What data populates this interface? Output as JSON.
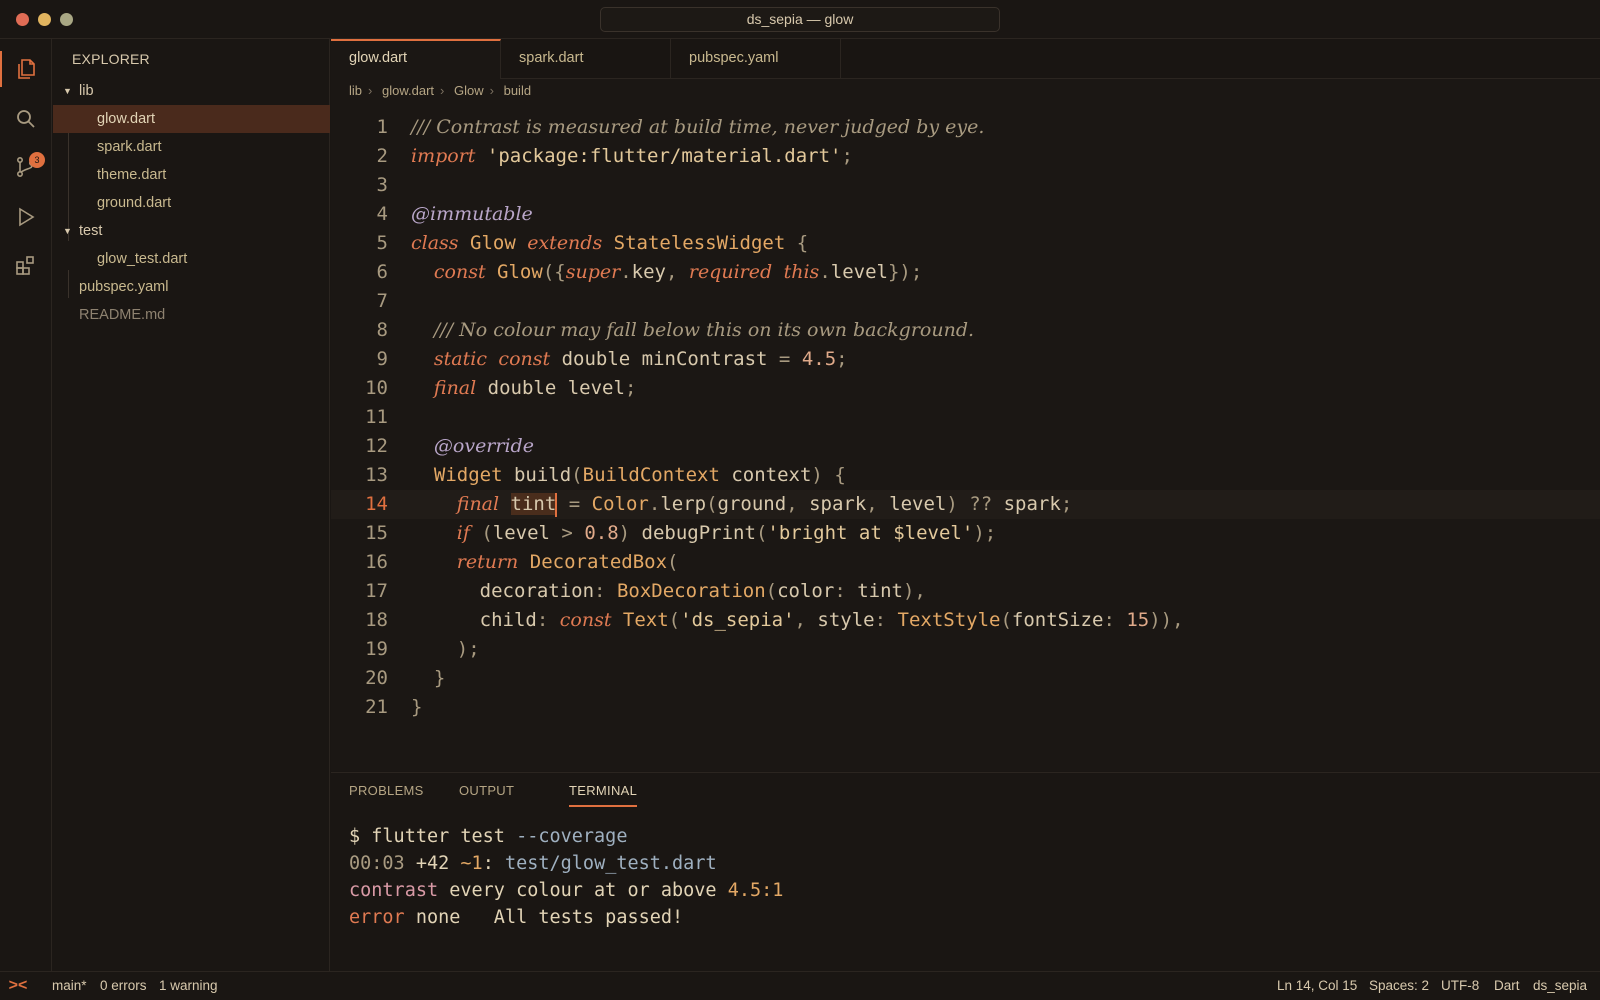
{
  "window": {
    "title": "ds_sepia — glow"
  },
  "activity_bar": {
    "scm_badge": "3"
  },
  "explorer": {
    "title": "EXPLORER",
    "items": [
      {
        "label": "lib",
        "type": "folder"
      },
      {
        "label": "glow.dart",
        "type": "file"
      },
      {
        "label": "spark.dart",
        "type": "file"
      },
      {
        "label": "theme.dart",
        "type": "file"
      },
      {
        "label": "ground.dart",
        "type": "file"
      },
      {
        "label": "test",
        "type": "folder"
      },
      {
        "label": "glow_test.dart",
        "type": "file"
      },
      {
        "label": "pubspec.yaml",
        "type": "file"
      },
      {
        "label": "README.md",
        "type": "file"
      }
    ]
  },
  "tabs": [
    "glow.dart",
    "spark.dart",
    "pubspec.yaml"
  ],
  "breadcrumb": [
    "lib",
    "glow.dart",
    "Glow",
    "build"
  ],
  "code": {
    "current_line": 14,
    "lines": [
      [
        [
          "c",
          "/// Contrast is measured at build time, never judged by eye."
        ]
      ],
      [
        [
          "k",
          "import"
        ],
        [
          "",
          " "
        ],
        [
          "s",
          "'package:flutter/material.dart'"
        ],
        [
          "p",
          ";"
        ]
      ],
      [],
      [
        [
          "a",
          "@immutable"
        ]
      ],
      [
        [
          "k",
          "class"
        ],
        [
          "",
          " "
        ],
        [
          "t",
          "Glow"
        ],
        [
          "",
          " "
        ],
        [
          "k",
          "extends"
        ],
        [
          "",
          " "
        ],
        [
          "t",
          "StatelessWidget"
        ],
        [
          "",
          " "
        ],
        [
          "p",
          "{"
        ]
      ],
      [
        [
          "",
          "  "
        ],
        [
          "k",
          "const"
        ],
        [
          "",
          " "
        ],
        [
          "t",
          "Glow"
        ],
        [
          "p",
          "({"
        ],
        [
          "k",
          "super"
        ],
        [
          "p",
          "."
        ],
        [
          "",
          "key"
        ],
        [
          "p",
          ", "
        ],
        [
          "k",
          "required"
        ],
        [
          "",
          " "
        ],
        [
          "k",
          "this"
        ],
        [
          "p",
          "."
        ],
        [
          "",
          "level"
        ],
        [
          "p",
          "});"
        ]
      ],
      [],
      [
        [
          "",
          "  "
        ],
        [
          "c",
          "/// No colour may fall below this on its own background."
        ]
      ],
      [
        [
          "",
          "  "
        ],
        [
          "k",
          "static"
        ],
        [
          "",
          " "
        ],
        [
          "k",
          "const"
        ],
        [
          "",
          " double minContrast "
        ],
        [
          "p",
          "="
        ],
        [
          "",
          " "
        ],
        [
          "n",
          "4.5"
        ],
        [
          "p",
          ";"
        ]
      ],
      [
        [
          "",
          "  "
        ],
        [
          "k",
          "final"
        ],
        [
          "",
          " double level"
        ],
        [
          "p",
          ";"
        ]
      ],
      [],
      [
        [
          "",
          "  "
        ],
        [
          "a",
          "@override"
        ]
      ],
      [
        [
          "",
          "  "
        ],
        [
          "t",
          "Widget"
        ],
        [
          "",
          " build"
        ],
        [
          "p",
          "("
        ],
        [
          "t",
          "BuildContext"
        ],
        [
          "",
          " context"
        ],
        [
          "p",
          ")"
        ],
        [
          "",
          " "
        ],
        [
          "p",
          "{"
        ]
      ],
      [
        [
          "",
          "    "
        ],
        [
          "k",
          "final"
        ],
        [
          "",
          " "
        ],
        [
          "hl",
          "tint"
        ],
        [
          "cursor",
          ""
        ],
        [
          "",
          " "
        ],
        [
          "p",
          "="
        ],
        [
          "",
          " "
        ],
        [
          "t",
          "Color"
        ],
        [
          "p",
          "."
        ],
        [
          "",
          "lerp"
        ],
        [
          "p",
          "("
        ],
        [
          "",
          "ground"
        ],
        [
          "p",
          ", "
        ],
        [
          "",
          "spark"
        ],
        [
          "p",
          ", "
        ],
        [
          "",
          "level"
        ],
        [
          "p",
          ")"
        ],
        [
          "",
          " "
        ],
        [
          "p",
          "??"
        ],
        [
          "",
          " spark"
        ],
        [
          "p",
          ";"
        ]
      ],
      [
        [
          "",
          "    "
        ],
        [
          "k",
          "if"
        ],
        [
          "",
          " "
        ],
        [
          "p",
          "("
        ],
        [
          "",
          "level "
        ],
        [
          "p",
          ">"
        ],
        [
          "",
          " "
        ],
        [
          "n",
          "0.8"
        ],
        [
          "p",
          ")"
        ],
        [
          "",
          " debugPrint"
        ],
        [
          "p",
          "("
        ],
        [
          "s",
          "'bright at $level'"
        ],
        [
          "p",
          ");"
        ]
      ],
      [
        [
          "",
          "    "
        ],
        [
          "k",
          "return"
        ],
        [
          "",
          " "
        ],
        [
          "t",
          "DecoratedBox"
        ],
        [
          "p",
          "("
        ]
      ],
      [
        [
          "",
          "      decoration"
        ],
        [
          "p",
          ":"
        ],
        [
          "",
          " "
        ],
        [
          "t",
          "BoxDecoration"
        ],
        [
          "p",
          "("
        ],
        [
          "",
          "color"
        ],
        [
          "p",
          ":"
        ],
        [
          "",
          " tint"
        ],
        [
          "p",
          "),"
        ]
      ],
      [
        [
          "",
          "      child"
        ],
        [
          "p",
          ":"
        ],
        [
          "",
          " "
        ],
        [
          "k",
          "const"
        ],
        [
          "",
          " "
        ],
        [
          "t",
          "Text"
        ],
        [
          "p",
          "("
        ],
        [
          "s",
          "'ds_sepia'"
        ],
        [
          "p",
          ", "
        ],
        [
          "",
          "style"
        ],
        [
          "p",
          ":"
        ],
        [
          "",
          " "
        ],
        [
          "t",
          "TextStyle"
        ],
        [
          "p",
          "("
        ],
        [
          "",
          "fontSize"
        ],
        [
          "p",
          ":"
        ],
        [
          "",
          " "
        ],
        [
          "n",
          "15"
        ],
        [
          "p",
          ")),"
        ]
      ],
      [
        [
          "",
          "    "
        ],
        [
          "p",
          ");"
        ]
      ],
      [
        [
          "",
          "  "
        ],
        [
          "p",
          "}"
        ]
      ],
      [
        [
          "p",
          "}"
        ]
      ]
    ]
  },
  "panel": {
    "tabs": [
      "PROBLEMS",
      "OUTPUT",
      "TERMINAL"
    ],
    "active_tab": "TERMINAL",
    "terminal": [
      [
        [
          "tw",
          "$ flutter test "
        ],
        [
          "tb",
          "--coverage"
        ]
      ],
      [
        [
          "tm",
          "00:03"
        ],
        [
          "tw",
          " +42 "
        ],
        [
          "tn",
          "~1"
        ],
        [
          "tw",
          ": "
        ],
        [
          "tb",
          "test/glow_test.dart"
        ]
      ],
      [
        [
          "tp",
          "contrast"
        ],
        [
          "tw",
          " every colour at or above "
        ],
        [
          "tn",
          "4.5:1"
        ]
      ],
      [
        [
          "tr",
          "error"
        ],
        [
          "tw",
          " none   All tests passed!"
        ]
      ]
    ]
  },
  "statusbar": {
    "remote_icon": "><",
    "branch": "main*",
    "errors": "0 errors",
    "warnings": "1 warning",
    "position": "Ln 14, Col 15",
    "spaces": "Spaces: 2",
    "encoding": "UTF-8",
    "language": "Dart",
    "theme": "ds_sepia"
  },
  "colors": {
    "accent": "#e0703f",
    "background": "#1a1613",
    "selection": "#4a2a1c"
  }
}
